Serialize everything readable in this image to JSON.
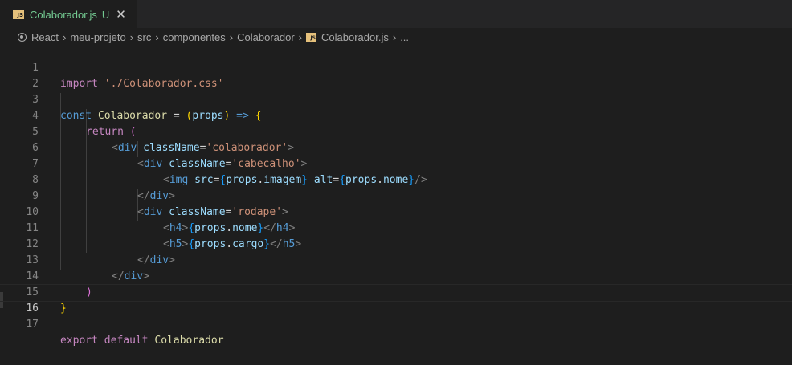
{
  "tab": {
    "icon_text": "JS",
    "title": "Colaborador.js",
    "status": "U",
    "close": "✕"
  },
  "breadcrumbs": {
    "items": [
      "React",
      "meu-projeto",
      "src",
      "componentes",
      "Colaborador",
      "Colaborador.js",
      "..."
    ],
    "separator": "›",
    "file_icon_text": "JS"
  },
  "editor": {
    "active_line": 16,
    "line_numbers": [
      "1",
      "2",
      "3",
      "4",
      "5",
      "6",
      "7",
      "8",
      "9",
      "10",
      "11",
      "12",
      "13",
      "14",
      "15",
      "16",
      "17"
    ],
    "code": {
      "l1": [
        "import",
        " ",
        "'./Colaborador.css'"
      ],
      "l3": [
        "const",
        " ",
        "Colaborador",
        " ",
        "=",
        " ",
        "(",
        "props",
        ")",
        " ",
        "=>",
        " ",
        "{"
      ],
      "l4": [
        "return",
        " ",
        "("
      ],
      "l5": [
        "<",
        "div",
        " ",
        "className",
        "=",
        "'colaborador'",
        ">"
      ],
      "l6": [
        "<",
        "div",
        " ",
        "className",
        "=",
        "'cabecalho'",
        ">"
      ],
      "l7": [
        "<",
        "img",
        " ",
        "src",
        "=",
        "{",
        "props",
        ".",
        "imagem",
        "}",
        " ",
        "alt",
        "=",
        "{",
        "props",
        ".",
        "nome",
        "}",
        "/>"
      ],
      "l8": [
        "</",
        "div",
        ">"
      ],
      "l9": [
        "<",
        "div",
        " ",
        "className",
        "=",
        "'rodape'",
        ">"
      ],
      "l10": [
        "<",
        "h4",
        ">",
        "{",
        "props",
        ".",
        "nome",
        "}",
        "</",
        "h4",
        ">"
      ],
      "l11": [
        "<",
        "h5",
        ">",
        "{",
        "props",
        ".",
        "cargo",
        "}",
        "</",
        "h5",
        ">"
      ],
      "l12": [
        "</",
        "div",
        ">"
      ],
      "l13": [
        "</",
        "div",
        ">"
      ],
      "l14": [
        ")"
      ],
      "l15": [
        "}"
      ],
      "l17": [
        "export",
        " ",
        "default",
        " ",
        "Colaborador"
      ]
    }
  },
  "colors": {
    "keyword": "#569cd6",
    "control": "#c586c0",
    "string": "#ce9178",
    "variable": "#9cdcfe",
    "function": "#dcdcaa",
    "modified": "#73c991"
  }
}
